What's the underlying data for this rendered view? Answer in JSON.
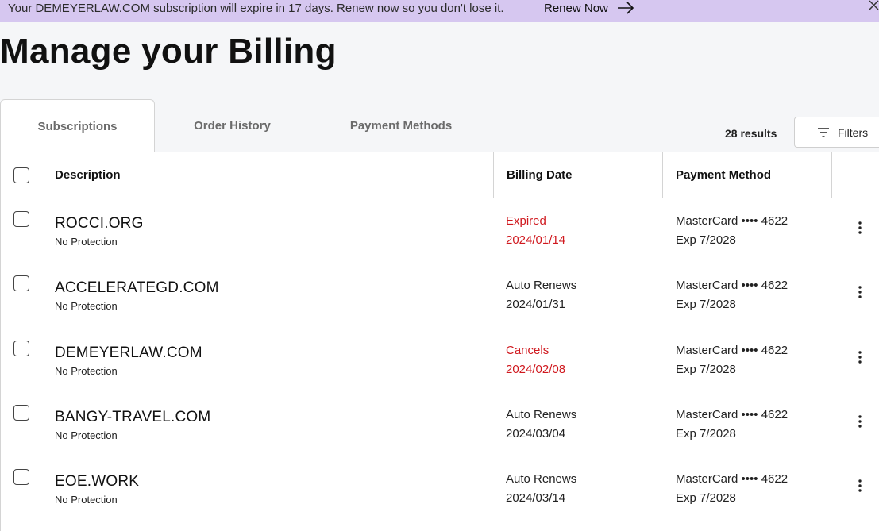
{
  "banner": {
    "message": "Your DEMEYERLAW.COM subscription will expire in 17 days. Renew now so you don't lose it.",
    "renew_label": "Renew Now"
  },
  "page_title": "Manage your Billing",
  "tabs": [
    {
      "label": "Subscriptions",
      "active": true
    },
    {
      "label": "Order History",
      "active": false
    },
    {
      "label": "Payment Methods",
      "active": false
    }
  ],
  "results_count": "28 results",
  "filters_label": "Filters",
  "table": {
    "headers": {
      "description": "Description",
      "billing_date": "Billing Date",
      "payment_method": "Payment Method"
    },
    "rows": [
      {
        "domain": "ROCCI.ORG",
        "protection": "No Protection",
        "status": "Expired",
        "date": "2024/01/14",
        "status_color": "#d0191f",
        "card": "MasterCard •••• 4622",
        "exp": "Exp 7/2028"
      },
      {
        "domain": "ACCELERATEGD.COM",
        "protection": "No Protection",
        "status": "Auto Renews",
        "date": "2024/01/31",
        "status_color": "#222222",
        "card": "MasterCard •••• 4622",
        "exp": "Exp 7/2028"
      },
      {
        "domain": "DEMEYERLAW.COM",
        "protection": "No Protection",
        "status": "Cancels",
        "date": "2024/02/08",
        "status_color": "#d0191f",
        "card": "MasterCard •••• 4622",
        "exp": "Exp 7/2028"
      },
      {
        "domain": "BANGY-TRAVEL.COM",
        "protection": "No Protection",
        "status": "Auto Renews",
        "date": "2024/03/04",
        "status_color": "#222222",
        "card": "MasterCard •••• 4622",
        "exp": "Exp 7/2028"
      },
      {
        "domain": "EOE.WORK",
        "protection": "No Protection",
        "status": "Auto Renews",
        "date": "2024/03/14",
        "status_color": "#222222",
        "card": "MasterCard •••• 4622",
        "exp": "Exp 7/2028"
      }
    ]
  },
  "colors": {
    "banner_bg": "#d6c7f0",
    "alert_red": "#d0191f",
    "page_bg": "#f5f6f8"
  },
  "icons": {
    "renew_arrow": "arrow-right-icon",
    "banner_close": "close-icon",
    "filters": "filter-icon",
    "row_menu": "more-vertical-icon"
  }
}
